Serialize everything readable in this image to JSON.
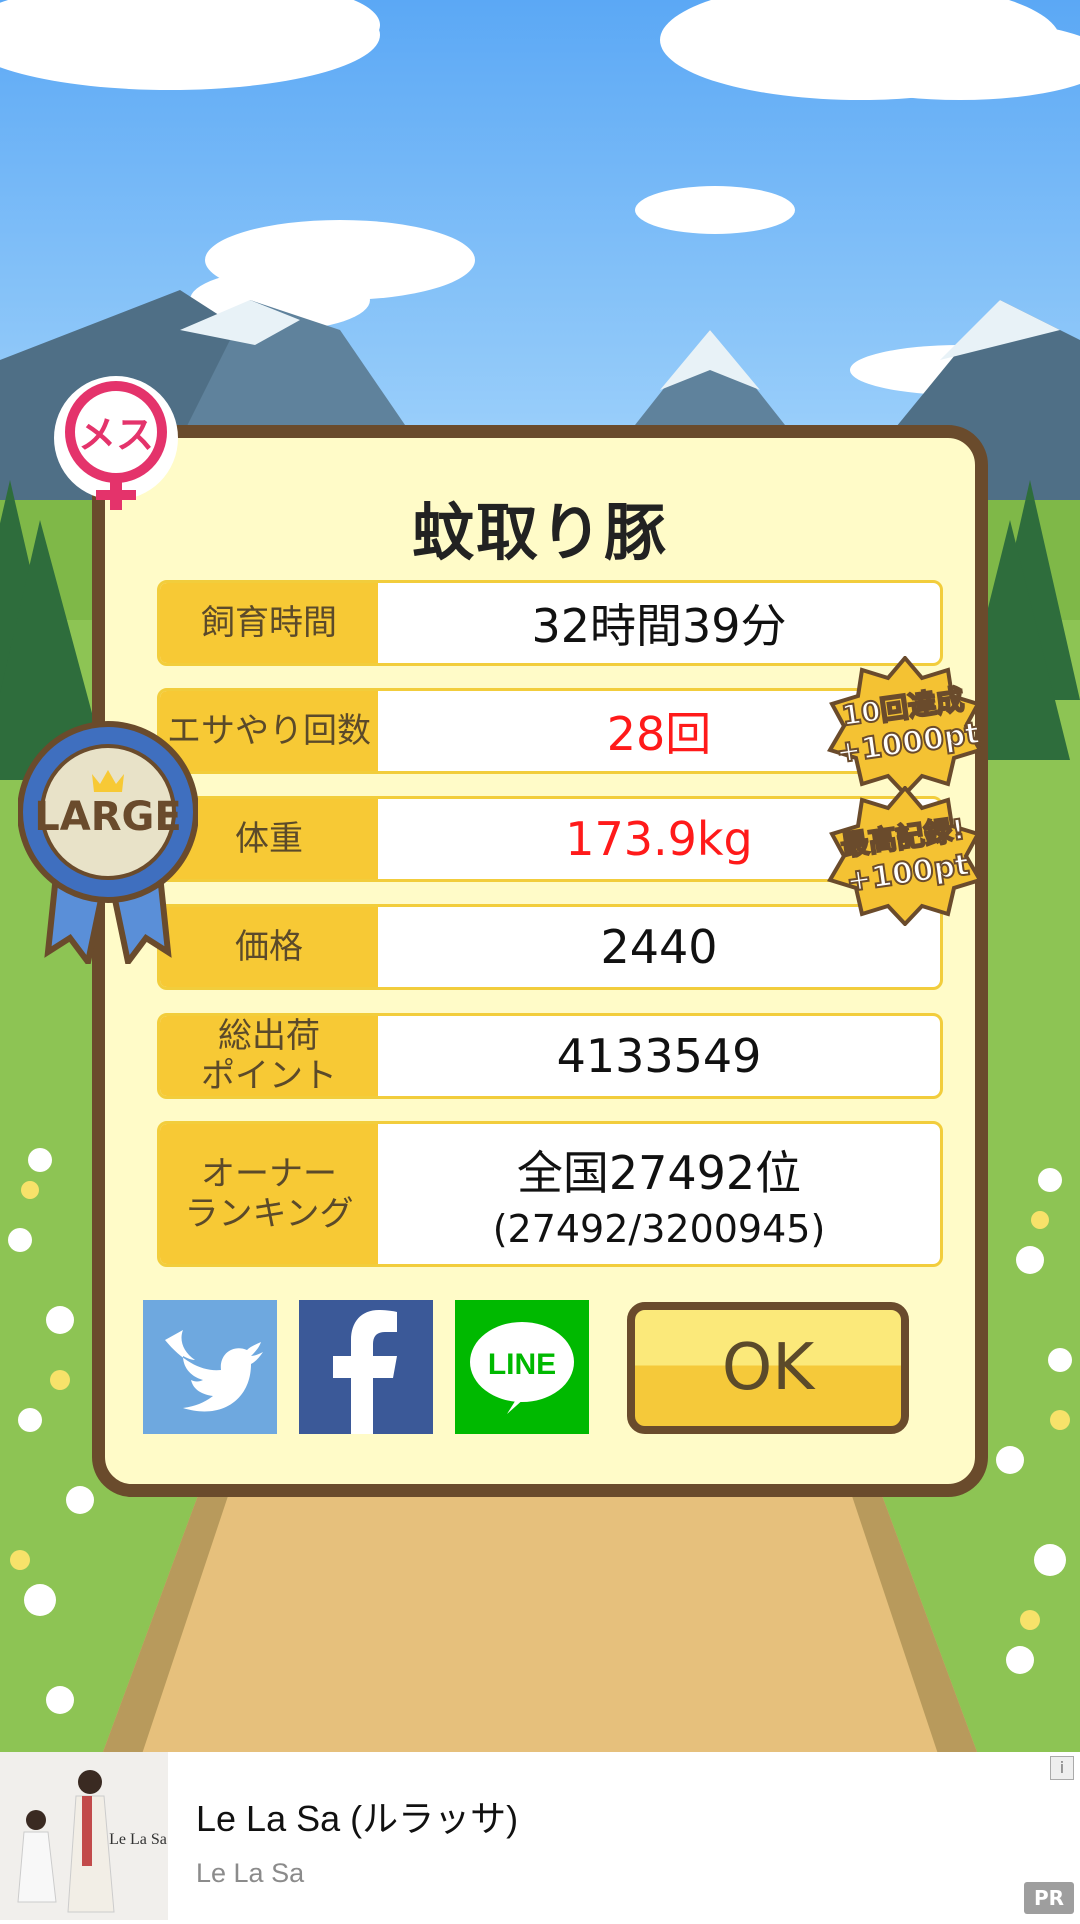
{
  "title": "蚊取り豚",
  "gender_badge": "メス",
  "size_ribbon": "LARGE",
  "stats": [
    {
      "label": "飼育時間",
      "value": "32時間39分",
      "highlight": false
    },
    {
      "label": "エサやり回数",
      "value": "28回",
      "highlight": true
    },
    {
      "label": "体重",
      "value": "173.9kg",
      "highlight": true
    },
    {
      "label": "価格",
      "value": "2440",
      "highlight": false
    },
    {
      "label": "総出荷\nポイント",
      "value": "4133549",
      "highlight": false
    },
    {
      "label": "オーナー\nランキング",
      "value": "全国27492位",
      "sub": "(27492/3200945)",
      "highlight": false
    }
  ],
  "bonus_badges": [
    {
      "line1": "10回達成",
      "line2": "+1000pt"
    },
    {
      "line1": "最高記録!",
      "line2": "+100pt"
    }
  ],
  "share": {
    "twitter": {
      "icon": "twitter-bird-icon",
      "color": "#6ea8df"
    },
    "facebook": {
      "icon": "facebook-f-icon",
      "color": "#3b5998"
    },
    "line": {
      "label": "LINE",
      "color": "#00b900"
    }
  },
  "ok_label": "OK",
  "ad": {
    "title": "Le La Sa (ルラッサ)",
    "advertiser": "Le La Sa",
    "thumb_logo": "Le La Sa",
    "pr_label": "PR",
    "info_icon": "info-icon"
  }
}
